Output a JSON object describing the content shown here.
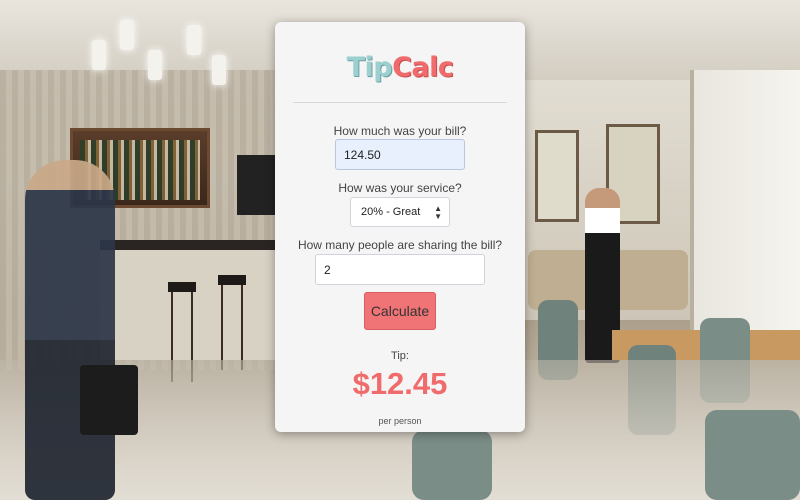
{
  "app": {
    "logo_part1": "Tip",
    "logo_part2": "Calc"
  },
  "form": {
    "bill_label": "How much was your bill?",
    "bill_value": "124.50",
    "service_label": "How was your service?",
    "service_selected": "20% - Great",
    "people_label": "How many people are sharing the bill?",
    "people_value": "2",
    "calculate_label": "Calculate"
  },
  "result": {
    "tip_label": "Tip:",
    "tip_amount": "$12.45",
    "per_person_label": "per person"
  },
  "colors": {
    "brand_teal": "#9ccfcf",
    "brand_red": "#f06b6b",
    "button": "#f07375"
  }
}
